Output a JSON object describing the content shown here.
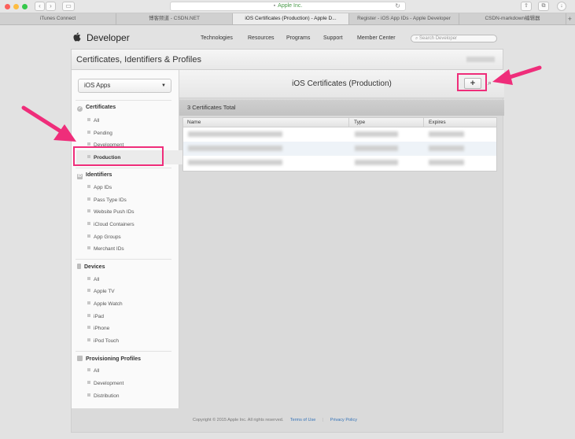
{
  "browser": {
    "address": "Apple Inc.",
    "tabs": [
      {
        "label": "iTunes Connect",
        "active": false
      },
      {
        "label": "博客频道 - CSDN.NET",
        "active": false
      },
      {
        "label": "iOS Certificates (Production) - Apple D...",
        "active": true
      },
      {
        "label": "Register - iOS App IDs - Apple Developer",
        "active": false
      },
      {
        "label": "CSDN-markdown编辑器",
        "active": false
      }
    ],
    "new_tab": "+"
  },
  "header": {
    "brand": "Developer",
    "nav": [
      "Technologies",
      "Resources",
      "Programs",
      "Support",
      "Member Center"
    ],
    "search_placeholder": "Search Developer"
  },
  "page_title": "Certificates, Identifiers & Profiles",
  "sidebar": {
    "app_select": "iOS Apps",
    "sections": [
      {
        "title": "Certificates",
        "items": [
          "All",
          "Pending",
          "Development",
          "Production"
        ],
        "selected": "Production"
      },
      {
        "title": "Identifiers",
        "items": [
          "App IDs",
          "Pass Type IDs",
          "Website Push IDs",
          "iCloud Containers",
          "App Groups",
          "Merchant IDs"
        ]
      },
      {
        "title": "Devices",
        "items": [
          "All",
          "Apple TV",
          "Apple Watch",
          "iPad",
          "iPhone",
          "iPod Touch"
        ]
      },
      {
        "title": "Provisioning Profiles",
        "items": [
          "All",
          "Development",
          "Distribution"
        ]
      }
    ]
  },
  "main": {
    "title": "iOS Certificates (Production)",
    "add_label": "+",
    "count_label": "3 Certificates Total",
    "columns": [
      "Name",
      "Type",
      "Expires"
    ]
  },
  "footer": {
    "copyright": "Copyright © 2015 Apple Inc. All rights reserved.",
    "links": [
      "Terms of Use",
      "Privacy Policy"
    ]
  },
  "colors": {
    "annotation": "#ef2d7a"
  }
}
